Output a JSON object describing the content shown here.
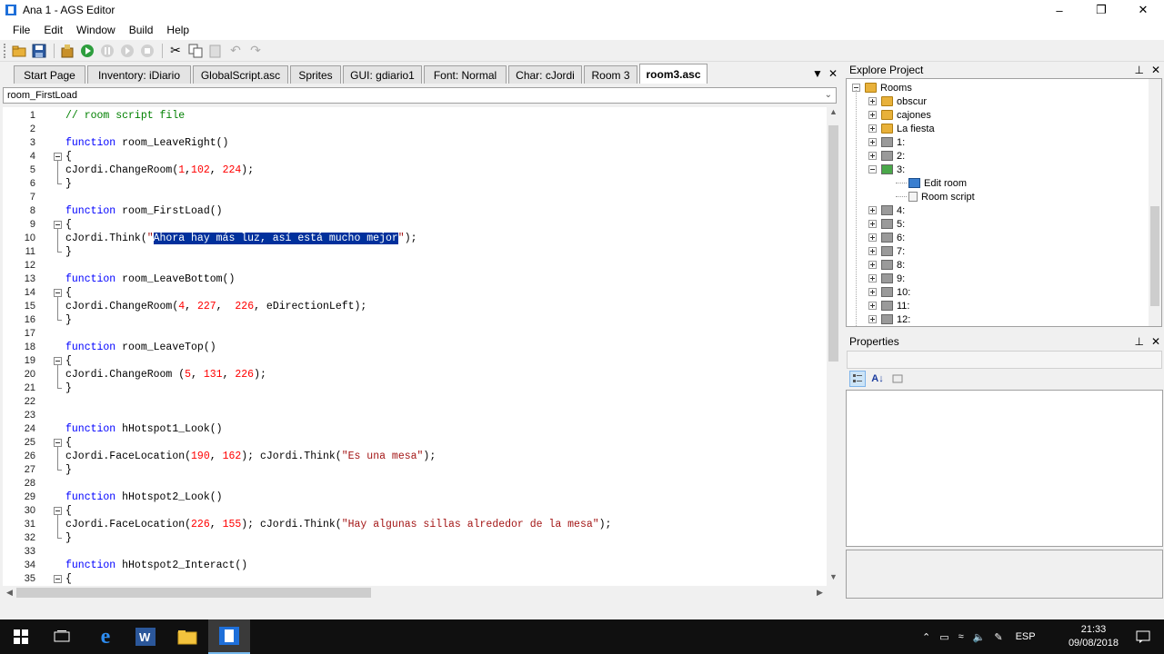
{
  "window": {
    "title": "Ana 1 - AGS Editor"
  },
  "menu": [
    "File",
    "Edit",
    "Window",
    "Build",
    "Help"
  ],
  "tabs": [
    "Start Page",
    "Inventory: iDiario",
    "GlobalScript.asc",
    "Sprites",
    "GUI: gdiario1",
    "Font: Normal",
    "Char: cJordi",
    "Room 3",
    "room3.asc"
  ],
  "active_tab": "room3.asc",
  "function_selector": "room_FirstLoad",
  "code_lines": [
    "// room script file",
    "",
    "function room_LeaveRight()",
    "{",
    "cJordi.ChangeRoom(1,102, 224);",
    "}",
    "",
    "function room_FirstLoad()",
    "{",
    "cJordi.Think(\"Ahora hay más luz, así está mucho mejor\");",
    "}",
    "",
    "function room_LeaveBottom()",
    "{",
    "cJordi.ChangeRoom(4, 227,  226, eDirectionLeft);",
    "}",
    "",
    "function room_LeaveTop()",
    "{",
    "cJordi.ChangeRoom (5, 131, 226);",
    "}",
    "",
    "",
    "function hHotspot1_Look()",
    "{",
    "cJordi.FaceLocation(190, 162); cJordi.Think(\"Es una mesa\");",
    "}",
    "",
    "function hHotspot2_Look()",
    "{",
    "cJordi.FaceLocation(226, 155); cJordi.Think(\"Hay algunas sillas alrededor de la mesa\");",
    "}",
    "",
    "function hHotspot2_Interact()",
    "{"
  ],
  "selected_text": "Ahora hay más luz, así está mucho mejor",
  "explorer": {
    "title": "Explore Project",
    "items": [
      {
        "label": "Rooms",
        "level": 0,
        "icon": "rooms-icon"
      },
      {
        "label": "obscur",
        "level": 1,
        "icon": "folder-icon"
      },
      {
        "label": "cajones",
        "level": 1,
        "icon": "folder-icon"
      },
      {
        "label": "La fiesta",
        "level": 1,
        "icon": "folder-icon"
      },
      {
        "label": "1:",
        "level": 1,
        "icon": "room-icon"
      },
      {
        "label": "2:",
        "level": 1,
        "icon": "room-icon"
      },
      {
        "label": "3:",
        "level": 1,
        "icon": "room-active-icon"
      },
      {
        "label": "Edit room",
        "level": 2,
        "icon": "edit-room-icon"
      },
      {
        "label": "Room script",
        "level": 2,
        "icon": "script-icon"
      },
      {
        "label": "4:",
        "level": 1,
        "icon": "room-icon"
      },
      {
        "label": "5:",
        "level": 1,
        "icon": "room-icon"
      },
      {
        "label": "6:",
        "level": 1,
        "icon": "room-icon"
      },
      {
        "label": "7:",
        "level": 1,
        "icon": "room-icon"
      },
      {
        "label": "8:",
        "level": 1,
        "icon": "room-icon"
      },
      {
        "label": "9:",
        "level": 1,
        "icon": "room-icon"
      },
      {
        "label": "10:",
        "level": 1,
        "icon": "room-icon"
      },
      {
        "label": "11:",
        "level": 1,
        "icon": "room-icon"
      },
      {
        "label": "12:",
        "level": 1,
        "icon": "room-icon"
      }
    ]
  },
  "properties": {
    "title": "Properties"
  },
  "taskbar": {
    "language": "ESP",
    "time": "21:33",
    "date": "09/08/2018"
  },
  "colors": {
    "keyword": "#0000ff",
    "comment": "#008000",
    "number": "#ff0000",
    "string": "#a31515",
    "selection": "#00309c"
  }
}
